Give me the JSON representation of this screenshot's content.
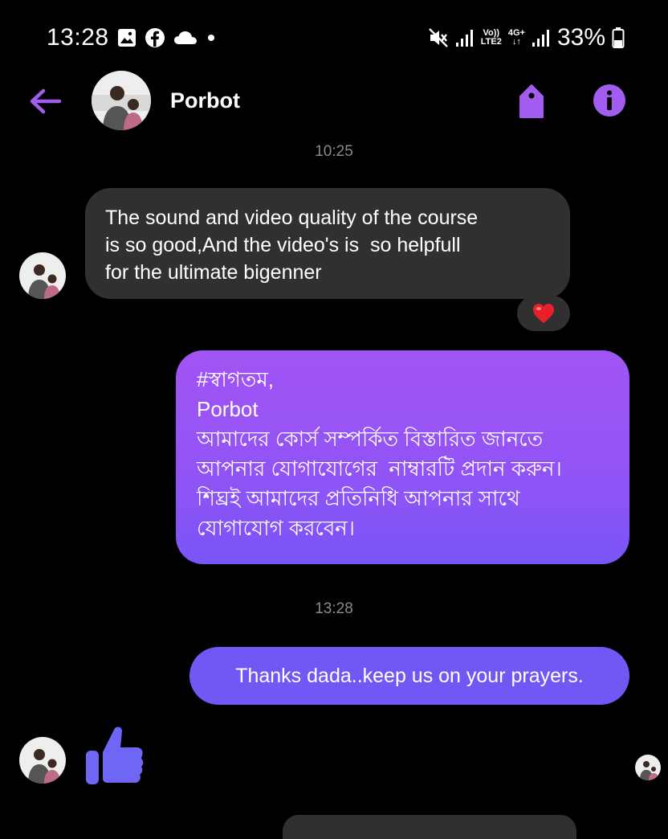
{
  "status_bar": {
    "time": "13:28",
    "volte_label": "Vo))",
    "lte_label": "LTE2",
    "network_label": "4G+",
    "battery_percent": "33%",
    "left_icons": [
      "gallery-icon",
      "facebook-icon",
      "cloud-icon",
      "dot-icon"
    ],
    "right_icons": [
      "mute-icon",
      "signal-icon",
      "signal-icon",
      "battery-icon"
    ]
  },
  "header": {
    "contact_name": "Porbot",
    "icons": [
      "back-arrow-icon",
      "tag-icon",
      "info-icon"
    ],
    "accent_color": "#a35cf0"
  },
  "conversation": {
    "timestamp_1": "10:25",
    "incoming_message": {
      "lines": [
        "The sound and video quality of the course",
        "is so good,And the video's is  so helpfull",
        "for the ultimate bigenner"
      ],
      "reaction": "❤️"
    },
    "outgoing_message_1": {
      "lines": [
        "#স্বাগতম,",
        "Porbot",
        "আমাদের কোর্স সম্পর্কিত বিস্তারিত জানতে",
        "আপনার যোগাযোগের  নাম্বারটি প্রদান করুন।",
        "শিঘ্রই আমাদের প্রতিনিধি আপনার সাথে",
        "যোগাযোগ করবেন।"
      ]
    },
    "timestamp_2": "13:28",
    "outgoing_message_2": {
      "text": "Thanks dada..keep us on your prayers."
    },
    "like_icon": "thumbs-up-icon"
  },
  "colors": {
    "background": "#000000",
    "incoming_bubble": "#303030",
    "outgoing_gradient_top": "#a155f3",
    "outgoing_gradient_bottom": "#7a55f8",
    "outgoing_solid": "#7157f4",
    "timestamp": "#8a8a8a"
  }
}
